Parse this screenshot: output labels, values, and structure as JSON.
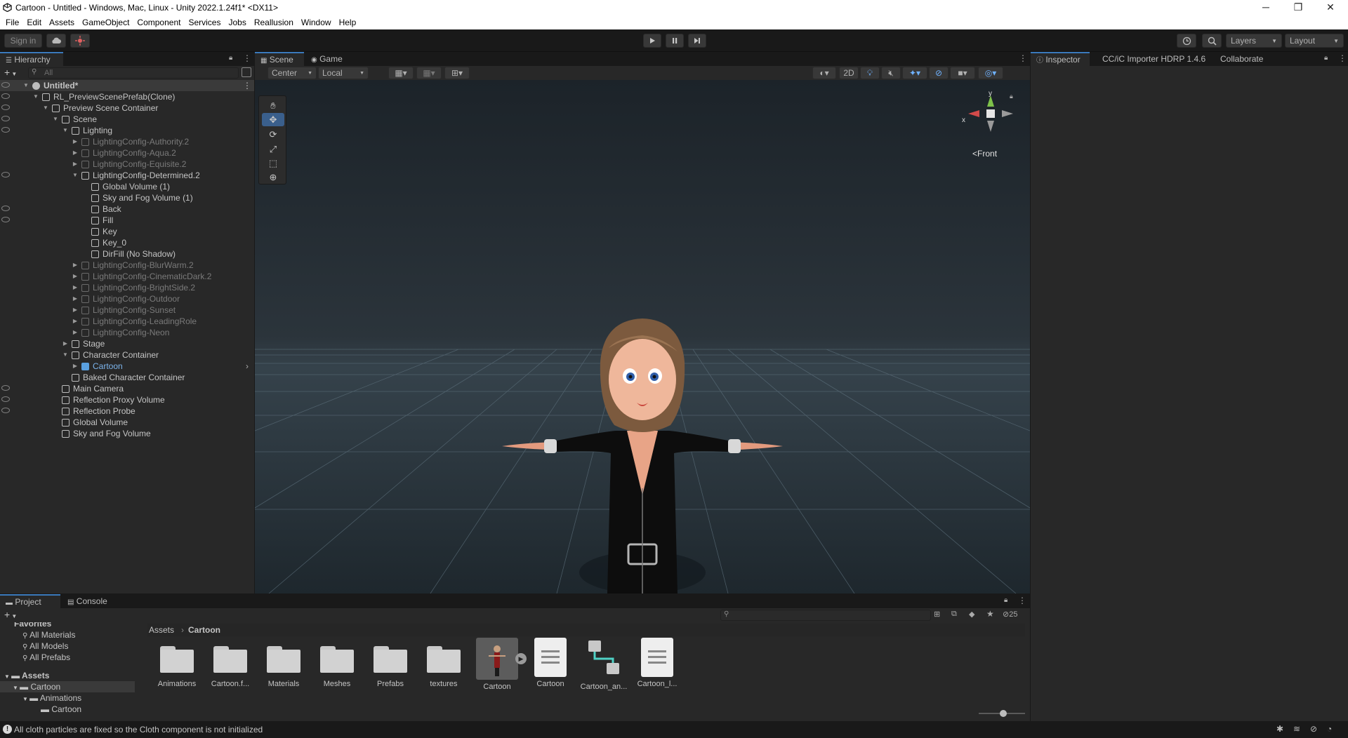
{
  "window": {
    "title": "Cartoon - Untitled - Windows, Mac, Linux - Unity 2022.1.24f1* <DX11>",
    "controls": {
      "minimize": "─",
      "maximize": "❐",
      "close": "✕"
    }
  },
  "menu": [
    "File",
    "Edit",
    "Assets",
    "GameObject",
    "Component",
    "Services",
    "Jobs",
    "Reallusion",
    "Window",
    "Help"
  ],
  "toolbar": {
    "sign_in": "Sign in",
    "layers": "Layers",
    "layout": "Layout"
  },
  "hierarchy": {
    "tab": "Hierarchy",
    "search_placeholder": "All",
    "items": [
      {
        "label": "Untitled*",
        "depth": 0,
        "expanded": true,
        "kind": "scene",
        "selected": true
      },
      {
        "label": "RL_PreviewScenePrefab(Clone)",
        "depth": 1,
        "expanded": true
      },
      {
        "label": "Preview Scene Container",
        "depth": 2,
        "expanded": true
      },
      {
        "label": "Scene",
        "depth": 3,
        "expanded": true
      },
      {
        "label": "Lighting",
        "depth": 4,
        "expanded": true
      },
      {
        "label": "LightingConfig-Authority.2",
        "depth": 5,
        "collapsed": true,
        "dim": true
      },
      {
        "label": "LightingConfig-Aqua.2",
        "depth": 5,
        "collapsed": true,
        "dim": true
      },
      {
        "label": "LightingConfig-Equisite.2",
        "depth": 5,
        "collapsed": true,
        "dim": true
      },
      {
        "label": "LightingConfig-Determined.2",
        "depth": 5,
        "expanded": true
      },
      {
        "label": "Global Volume (1)",
        "depth": 6
      },
      {
        "label": "Sky and Fog Volume (1)",
        "depth": 6
      },
      {
        "label": "Back",
        "depth": 6
      },
      {
        "label": "Fill",
        "depth": 6
      },
      {
        "label": "Key",
        "depth": 6
      },
      {
        "label": "Key_0",
        "depth": 6
      },
      {
        "label": "DirFill (No Shadow)",
        "depth": 6
      },
      {
        "label": "LightingConfig-BlurWarm.2",
        "depth": 5,
        "collapsed": true,
        "dim": true
      },
      {
        "label": "LightingConfig-CinematicDark.2",
        "depth": 5,
        "collapsed": true,
        "dim": true
      },
      {
        "label": "LightingConfig-BrightSide.2",
        "depth": 5,
        "collapsed": true,
        "dim": true
      },
      {
        "label": "LightingConfig-Outdoor",
        "depth": 5,
        "collapsed": true,
        "dim": true
      },
      {
        "label": "LightingConfig-Sunset",
        "depth": 5,
        "collapsed": true,
        "dim": true
      },
      {
        "label": "LightingConfig-LeadingRole",
        "depth": 5,
        "collapsed": true,
        "dim": true
      },
      {
        "label": "LightingConfig-Neon",
        "depth": 5,
        "collapsed": true,
        "dim": true
      },
      {
        "label": "Stage",
        "depth": 4,
        "collapsed": true
      },
      {
        "label": "Character Container",
        "depth": 4,
        "expanded": true
      },
      {
        "label": "Cartoon",
        "depth": 5,
        "collapsed": true,
        "kind": "prefab"
      },
      {
        "label": "Baked Character Container",
        "depth": 4
      },
      {
        "label": "Main Camera",
        "depth": 3
      },
      {
        "label": "Reflection Proxy Volume",
        "depth": 3
      },
      {
        "label": "Reflection Probe",
        "depth": 3
      },
      {
        "label": "Global Volume",
        "depth": 3
      },
      {
        "label": "Sky and Fog Volume",
        "depth": 3
      }
    ]
  },
  "scene_view": {
    "tabs": [
      "Scene",
      "Game"
    ],
    "pivot_mode": "Center",
    "pivot_rotation": "Local",
    "mode_2d": "2D",
    "gizmo_view": "Front",
    "gizmo_axes": {
      "x": "x",
      "y": "y"
    }
  },
  "inspector": {
    "tabs": [
      "Inspector",
      "CC/iC Importer HDRP 1.4.6",
      "Collaborate"
    ]
  },
  "project": {
    "tabs": [
      "Project",
      "Console"
    ],
    "hidden_count": "25",
    "favorites_header": "Favorites",
    "favorites": [
      "All Materials",
      "All Models",
      "All Prefabs"
    ],
    "tree_header": "Assets",
    "tree": [
      {
        "label": "Cartoon",
        "depth": 1,
        "selected": true
      },
      {
        "label": "Animations",
        "depth": 2
      },
      {
        "label": "Cartoon",
        "depth": 3
      }
    ],
    "breadcrumb": [
      "Assets",
      "Cartoon"
    ],
    "assets": [
      {
        "label": "Animations",
        "type": "folder"
      },
      {
        "label": "Cartoon.f...",
        "type": "folder"
      },
      {
        "label": "Materials",
        "type": "folder"
      },
      {
        "label": "Meshes",
        "type": "folder"
      },
      {
        "label": "Prefabs",
        "type": "folder"
      },
      {
        "label": "textures",
        "type": "folder"
      },
      {
        "label": "Cartoon",
        "type": "model"
      },
      {
        "label": "Cartoon",
        "type": "document"
      },
      {
        "label": "Cartoon_an...",
        "type": "animator"
      },
      {
        "label": "Cartoon_l...",
        "type": "document"
      }
    ]
  },
  "status": {
    "message": "All cloth particles are fixed so the Cloth component is not initialized"
  }
}
